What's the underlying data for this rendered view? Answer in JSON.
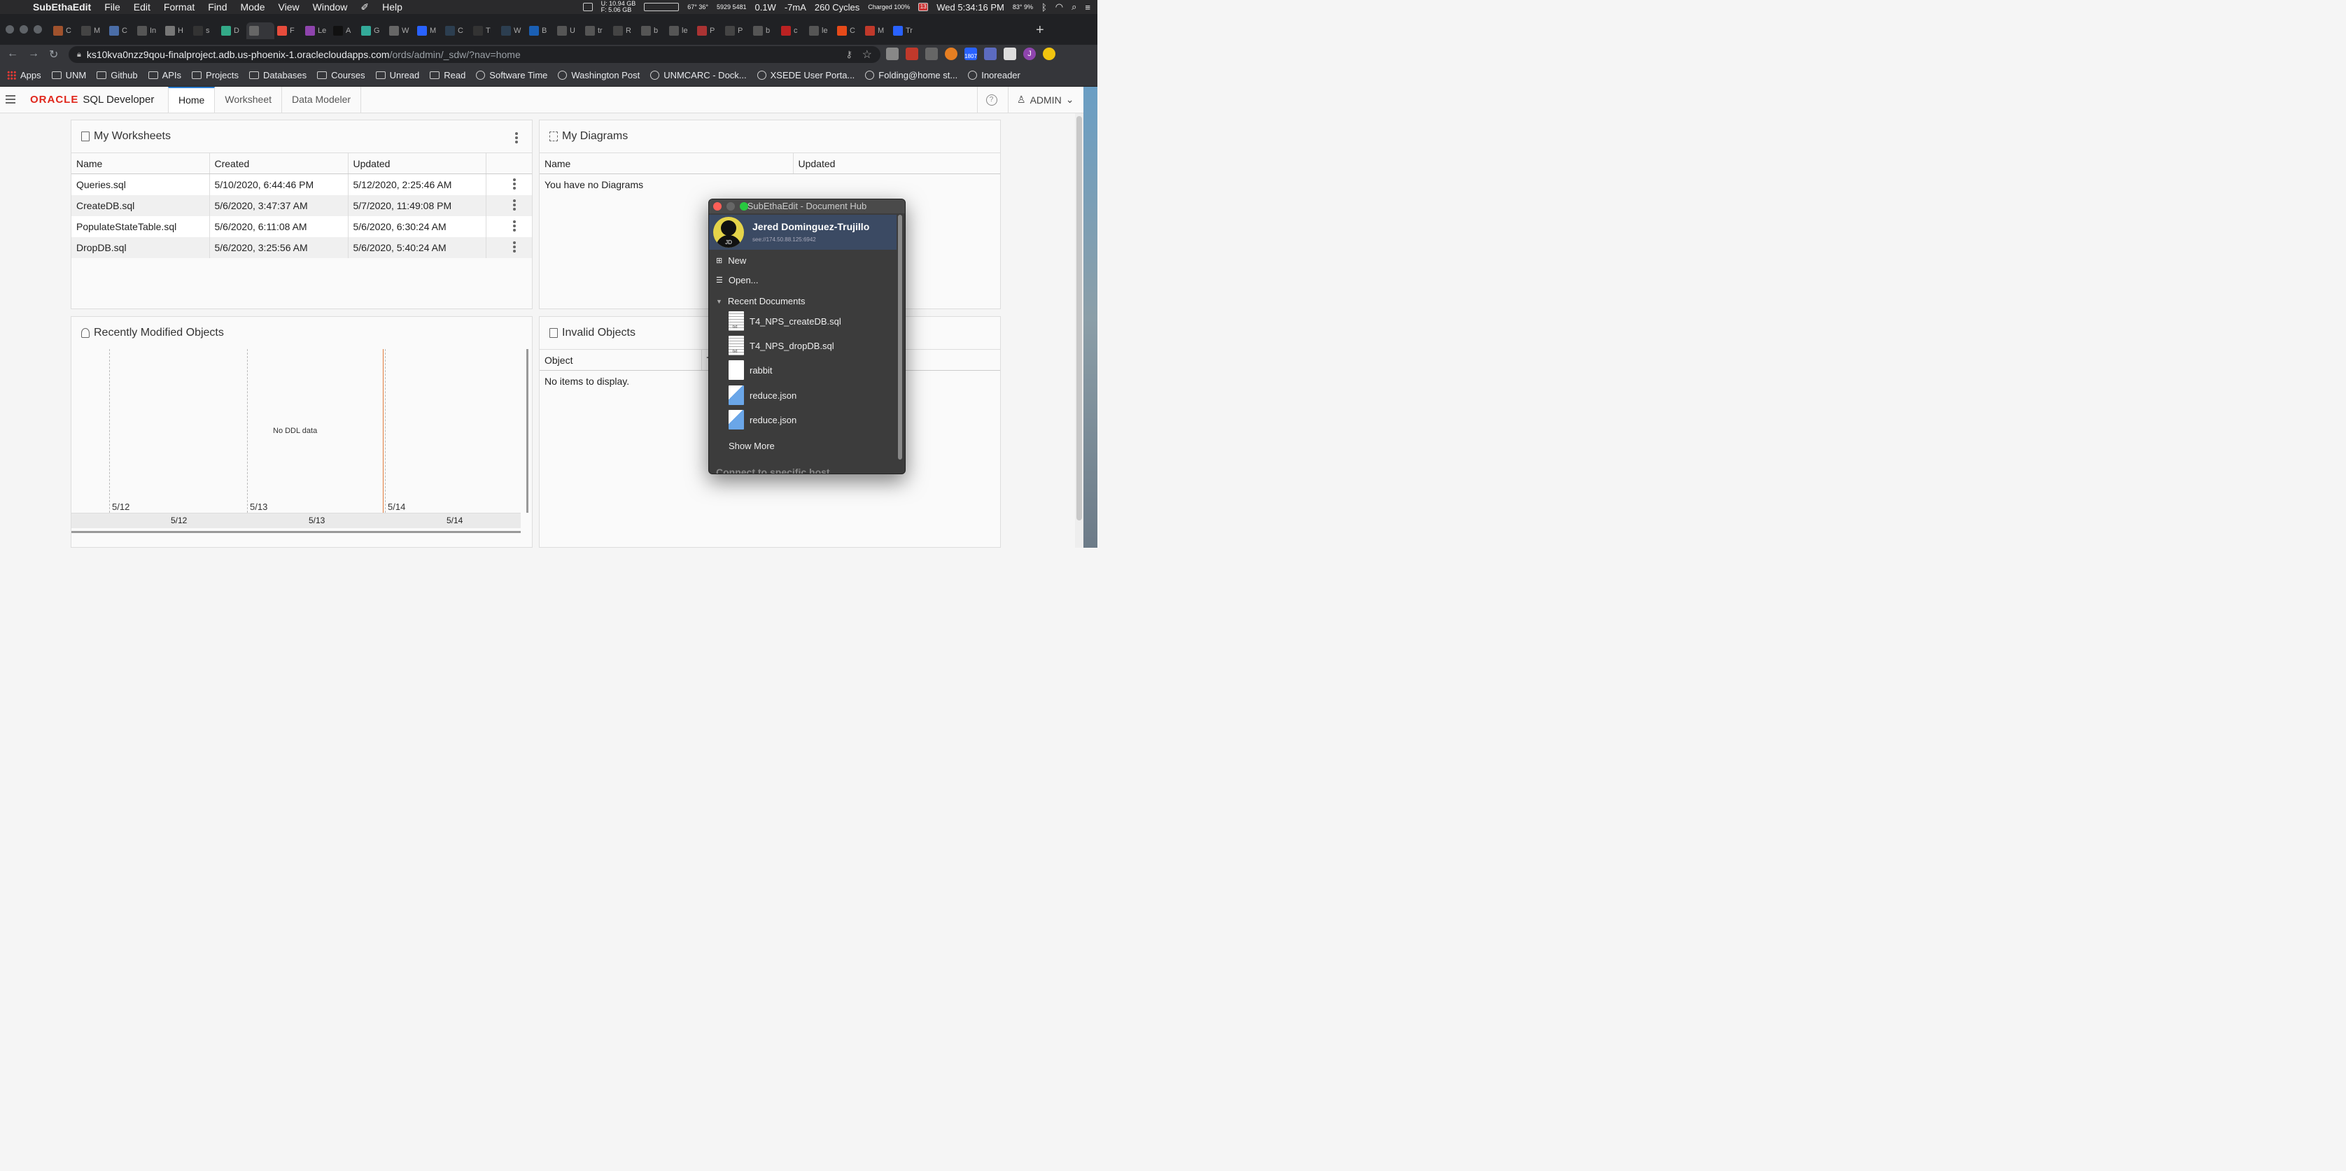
{
  "menubar": {
    "app": "SubEthaEdit",
    "items": [
      "File",
      "Edit",
      "Format",
      "Find",
      "Mode",
      "View",
      "Window",
      "Help"
    ],
    "mem_u": "U: 10.94 GB",
    "mem_f": "F: 5.06 GB",
    "temp": "67° 36°",
    "fan": "5929 5481",
    "power": "0.1W",
    "current": "-7mA",
    "cycles": "260 Cycles",
    "battery": "Charged 100%",
    "date_badge": "13",
    "clock": "Wed 5:34:16 PM",
    "weather": "83° 9%"
  },
  "browser": {
    "tabs": [
      "C",
      "M",
      "C",
      "In",
      "H",
      "s",
      "D",
      "",
      "F",
      "Le",
      "A",
      "G",
      "W",
      "M",
      "C",
      "T",
      "W",
      "B",
      "U",
      "tr",
      "R",
      "b",
      "le",
      "P",
      "P",
      "b",
      "c",
      "le",
      "C",
      "M",
      "Tr"
    ],
    "active_tab_index": 7,
    "url_host": "ks10kva0nzz9qou-finalproject.adb.us-phoenix-1.oraclecloudapps.com",
    "url_path": "/ords/admin/_sdw/?nav=home",
    "ext_badge": "1807",
    "profile_initial": "J",
    "bookmarks": [
      "Apps",
      "UNM",
      "Github",
      "APIs",
      "Projects",
      "Databases",
      "Courses",
      "Unread",
      "Read",
      "Software Time",
      "Washington Post",
      "UNMCARC - Dock...",
      "XSEDE User Porta...",
      "Folding@home st...",
      "Inoreader"
    ]
  },
  "sqldev": {
    "brand_oracle": "ORACLE",
    "brand_product": "SQL Developer",
    "tabs": [
      "Home",
      "Worksheet",
      "Data Modeler"
    ],
    "help": "?",
    "user": "ADMIN"
  },
  "worksheets": {
    "title": "My Worksheets",
    "columns": [
      "Name",
      "Created",
      "Updated"
    ],
    "rows": [
      {
        "name": "Queries.sql",
        "created": "5/10/2020, 6:44:46 PM",
        "updated": "5/12/2020, 2:25:46 AM"
      },
      {
        "name": "CreateDB.sql",
        "created": "5/6/2020, 3:47:37 AM",
        "updated": "5/7/2020, 11:49:08 PM"
      },
      {
        "name": "PopulateStateTable.sql",
        "created": "5/6/2020, 6:11:08 AM",
        "updated": "5/6/2020, 6:30:24 AM"
      },
      {
        "name": "DropDB.sql",
        "created": "5/6/2020, 3:25:56 AM",
        "updated": "5/6/2020, 5:40:24 AM"
      }
    ]
  },
  "diagrams": {
    "title": "My Diagrams",
    "columns": [
      "Name",
      "Updated"
    ],
    "empty": "You have no Diagrams"
  },
  "recent": {
    "title": "Recently Modified Objects",
    "empty": "No DDL data",
    "dates": [
      "5/12",
      "5/13",
      "5/14"
    ],
    "axis": [
      "5/12",
      "5/13",
      "5/14"
    ]
  },
  "invalid": {
    "title": "Invalid Objects",
    "columns": [
      "Object",
      "T"
    ],
    "empty": "No items to display."
  },
  "hub": {
    "title": "SubEthaEdit - Document Hub",
    "user_name": "Jered Dominguez-Trujillo",
    "user_initials": "JD",
    "user_address": "see://174.50.88.125:6942",
    "new": "New",
    "open": "Open...",
    "recent_header": "Recent Documents",
    "docs": [
      "T4_NPS_createDB.sql",
      "T4_NPS_dropDB.sql",
      "rabbit",
      "reduce.json",
      "reduce.json"
    ],
    "show_more": "Show More",
    "connect": "Connect to specific host"
  },
  "colors": {
    "oracle_red": "#e0261b",
    "accent_blue": "#2d7ed1",
    "hub_selected": "#3b4a63"
  }
}
